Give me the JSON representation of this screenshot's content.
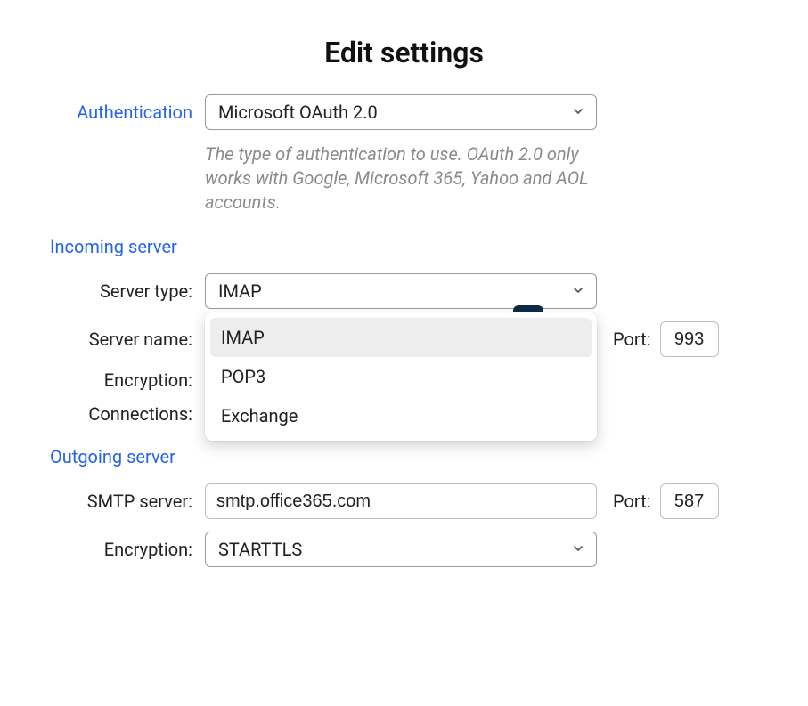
{
  "title": "Edit settings",
  "auth": {
    "label": "Authentication",
    "selected": "Microsoft OAuth 2.0",
    "helper": "The type of authentication to use. OAuth 2.0 only works with Google, Microsoft 365, Yahoo and AOL accounts."
  },
  "incoming": {
    "section": "Incoming server",
    "server_type_label": "Server type:",
    "server_type_selected": "IMAP",
    "server_type_options": [
      "IMAP",
      "POP3",
      "Exchange"
    ],
    "server_name_label": "Server name:",
    "server_name_value": "",
    "encryption_label": "Encryption:",
    "encryption_value": "",
    "connections_label": "Connections:",
    "port_label": "Port:",
    "port_value": "993"
  },
  "outgoing": {
    "section": "Outgoing server",
    "smtp_label": "SMTP server:",
    "smtp_value": "smtp.office365.com",
    "port_label": "Port:",
    "port_value": "587",
    "encryption_label": "Encryption:",
    "encryption_selected": "STARTTLS"
  }
}
